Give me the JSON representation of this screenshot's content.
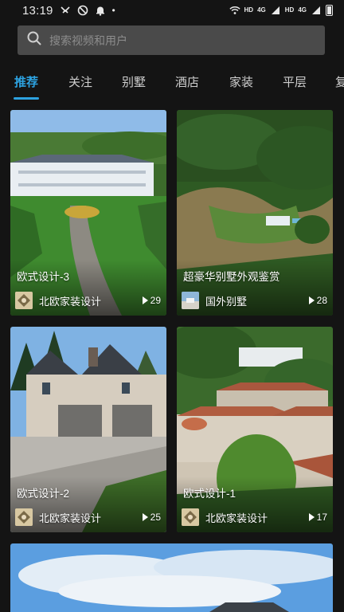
{
  "status_bar": {
    "time": "13:19",
    "dot": "•",
    "net1": "HD",
    "net2": "4G",
    "net3": "HD",
    "net4": "4G"
  },
  "search": {
    "placeholder": "搜索视频和用户"
  },
  "tabs": [
    {
      "label": "推荐",
      "active": true
    },
    {
      "label": "关注"
    },
    {
      "label": "别墅"
    },
    {
      "label": "酒店"
    },
    {
      "label": "家装"
    },
    {
      "label": "平层"
    },
    {
      "label": "复"
    }
  ],
  "feed": [
    {
      "title": "欧式设计-3",
      "author": "北欧家装设计",
      "views": "29"
    },
    {
      "title": "超豪华别墅外观鉴赏",
      "author": "国外别墅",
      "views": "28"
    },
    {
      "title": "欧式设计-2",
      "author": "北欧家装设计",
      "views": "25"
    },
    {
      "title": "欧式设计-1",
      "author": "北欧家装设计",
      "views": "17"
    }
  ],
  "colors": {
    "accent": "#2da2e0",
    "background": "#141414",
    "search_bg": "#4a4a4a"
  }
}
